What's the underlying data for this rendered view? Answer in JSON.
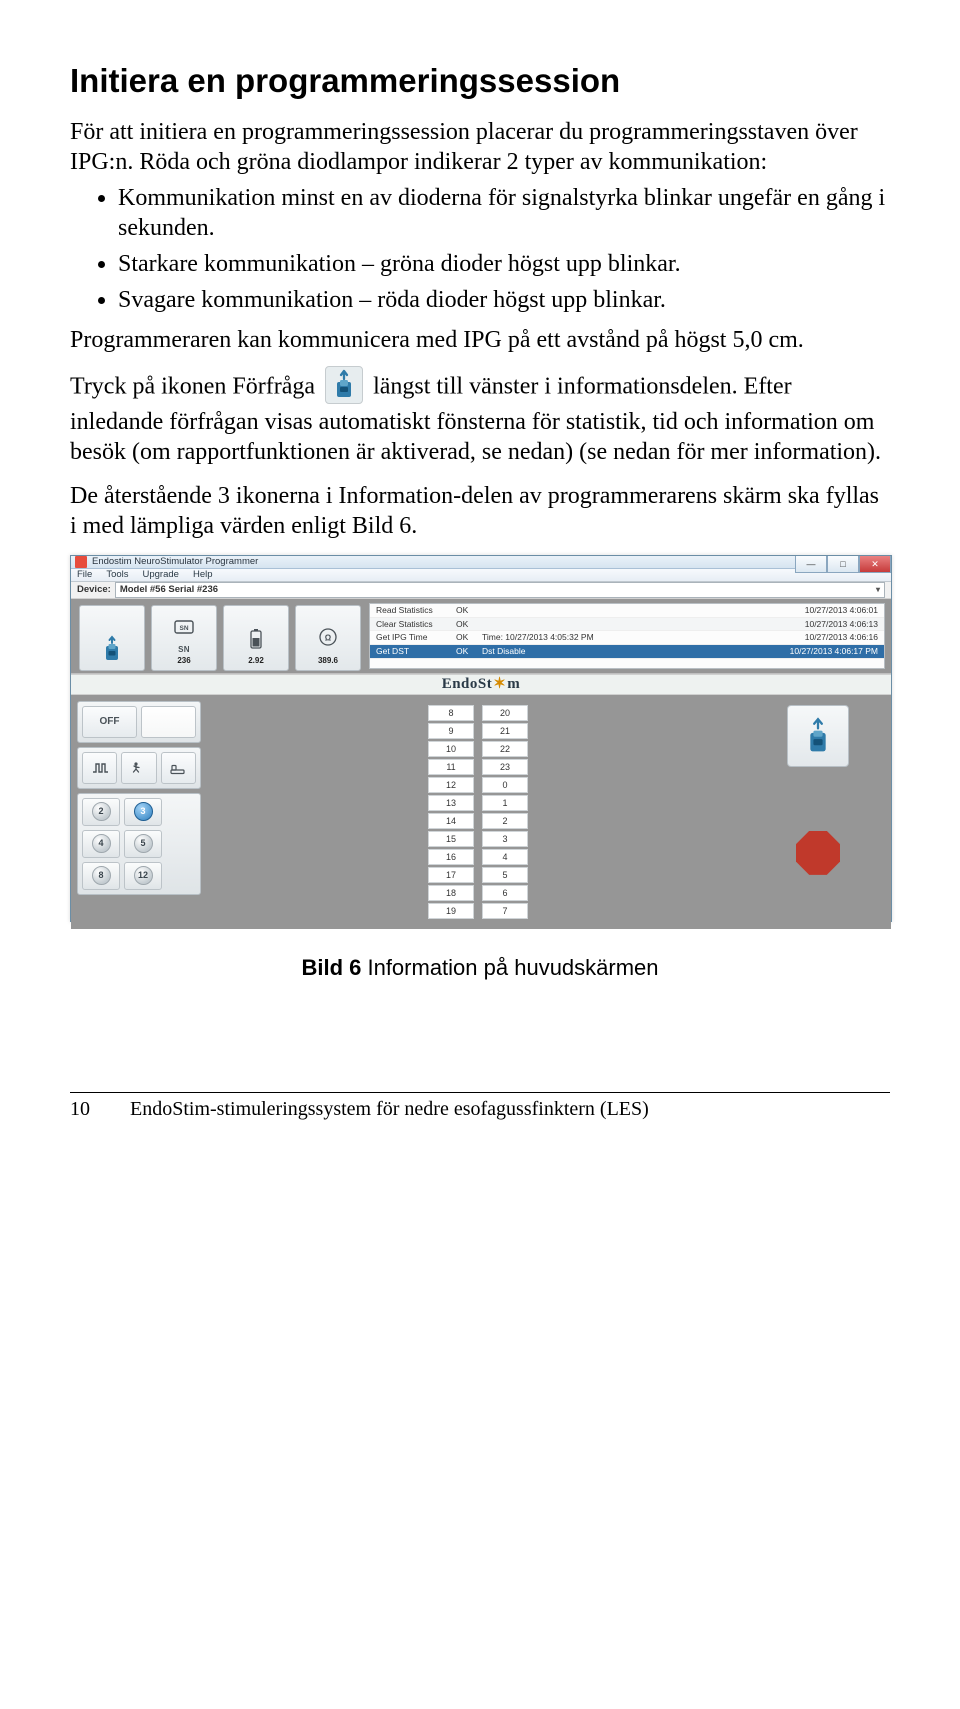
{
  "heading": "Initiera en programmeringssession",
  "intro": "För att initiera en programmeringssession placerar du programmeringsstaven över IPG:n. Röda och gröna diodlampor indikerar 2 typer av kommunikation:",
  "bullets": [
    "Kommunikation minst en av dioderna för signalstyrka blinkar ungefär en gång i sekunden.",
    "Starkare kommunikation – gröna dioder högst upp blinkar.",
    "Svagare kommunikation – röda dioder högst upp blinkar."
  ],
  "p2": "Programmeraren kan kommunicera med IPG på ett avstånd på högst 5,0 cm.",
  "p3a": "Tryck på ikonen Förfråga",
  "p3b": "längst till vänster i informationsdelen. Efter inledande förfrågan visas automatiskt fönsterna för statistik, tid och information om besök (om rapportfunktionen är aktiverad, se nedan) (se nedan för mer information).",
  "p4": "De återstående 3 ikonerna i Information-delen av programmerarens skärm ska fyllas i med lämpliga värden enligt Bild 6.",
  "caption_b": "Bild 6",
  "caption_t": " Information på huvudskärmen",
  "footer_page": "10",
  "footer_text": "EndoStim-stimuleringssystem för nedre esofagussfinktern (LES)",
  "app": {
    "title": "Endostim NeuroStimulator Programmer",
    "menus": [
      "File",
      "Tools",
      "Upgrade",
      "Help"
    ],
    "device_label": "Device:",
    "device_value": "Model #56 Serial #236",
    "info_cards": [
      {
        "label": "SN",
        "value": "236"
      },
      {
        "label": "",
        "value": "2.92"
      },
      {
        "label": "Ω",
        "value": "389.6"
      }
    ],
    "log": [
      {
        "c1": "Read Statistics",
        "c2": "OK",
        "c3": "",
        "c4": "10/27/2013 4:06:01"
      },
      {
        "c1": "Clear Statistics",
        "c2": "OK",
        "c3": "",
        "c4": "10/27/2013 4:06:13"
      },
      {
        "c1": "Get IPG Time",
        "c2": "OK",
        "c3": "Time: 10/27/2013 4:05:32 PM",
        "c4": "10/27/2013 4:06:16"
      },
      {
        "c1": "Get DST",
        "c2": "OK",
        "c3": "Dst Disable",
        "c4": "10/27/2013 4:06:17 PM"
      }
    ],
    "logo": "EndoStim",
    "off_label": "OFF",
    "number_buttons": [
      "2",
      "3",
      "4",
      "5",
      "8",
      "12"
    ],
    "selected_num": "3",
    "table": {
      "left": [
        "8",
        "9",
        "10",
        "11",
        "12",
        "13",
        "14",
        "15",
        "16",
        "17",
        "18",
        "19"
      ],
      "right": [
        "20",
        "21",
        "22",
        "23",
        "0",
        "1",
        "2",
        "3",
        "4",
        "5",
        "6",
        "7"
      ]
    }
  }
}
